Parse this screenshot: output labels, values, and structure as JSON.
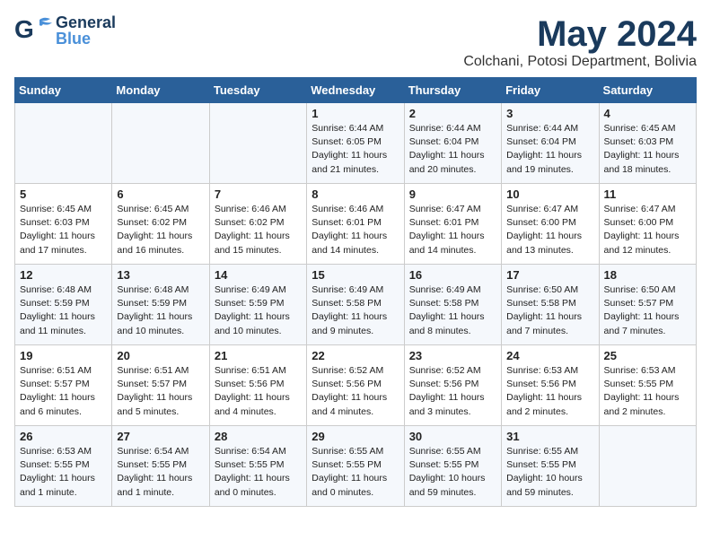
{
  "header": {
    "logo_general": "General",
    "logo_blue": "Blue",
    "month": "May 2024",
    "location": "Colchani, Potosi Department, Bolivia"
  },
  "days_of_week": [
    "Sunday",
    "Monday",
    "Tuesday",
    "Wednesday",
    "Thursday",
    "Friday",
    "Saturday"
  ],
  "weeks": [
    [
      {
        "day": "",
        "content": ""
      },
      {
        "day": "",
        "content": ""
      },
      {
        "day": "",
        "content": ""
      },
      {
        "day": "1",
        "content": "Sunrise: 6:44 AM\nSunset: 6:05 PM\nDaylight: 11 hours\nand 21 minutes."
      },
      {
        "day": "2",
        "content": "Sunrise: 6:44 AM\nSunset: 6:04 PM\nDaylight: 11 hours\nand 20 minutes."
      },
      {
        "day": "3",
        "content": "Sunrise: 6:44 AM\nSunset: 6:04 PM\nDaylight: 11 hours\nand 19 minutes."
      },
      {
        "day": "4",
        "content": "Sunrise: 6:45 AM\nSunset: 6:03 PM\nDaylight: 11 hours\nand 18 minutes."
      }
    ],
    [
      {
        "day": "5",
        "content": "Sunrise: 6:45 AM\nSunset: 6:03 PM\nDaylight: 11 hours\nand 17 minutes."
      },
      {
        "day": "6",
        "content": "Sunrise: 6:45 AM\nSunset: 6:02 PM\nDaylight: 11 hours\nand 16 minutes."
      },
      {
        "day": "7",
        "content": "Sunrise: 6:46 AM\nSunset: 6:02 PM\nDaylight: 11 hours\nand 15 minutes."
      },
      {
        "day": "8",
        "content": "Sunrise: 6:46 AM\nSunset: 6:01 PM\nDaylight: 11 hours\nand 14 minutes."
      },
      {
        "day": "9",
        "content": "Sunrise: 6:47 AM\nSunset: 6:01 PM\nDaylight: 11 hours\nand 14 minutes."
      },
      {
        "day": "10",
        "content": "Sunrise: 6:47 AM\nSunset: 6:00 PM\nDaylight: 11 hours\nand 13 minutes."
      },
      {
        "day": "11",
        "content": "Sunrise: 6:47 AM\nSunset: 6:00 PM\nDaylight: 11 hours\nand 12 minutes."
      }
    ],
    [
      {
        "day": "12",
        "content": "Sunrise: 6:48 AM\nSunset: 5:59 PM\nDaylight: 11 hours\nand 11 minutes."
      },
      {
        "day": "13",
        "content": "Sunrise: 6:48 AM\nSunset: 5:59 PM\nDaylight: 11 hours\nand 10 minutes."
      },
      {
        "day": "14",
        "content": "Sunrise: 6:49 AM\nSunset: 5:59 PM\nDaylight: 11 hours\nand 10 minutes."
      },
      {
        "day": "15",
        "content": "Sunrise: 6:49 AM\nSunset: 5:58 PM\nDaylight: 11 hours\nand 9 minutes."
      },
      {
        "day": "16",
        "content": "Sunrise: 6:49 AM\nSunset: 5:58 PM\nDaylight: 11 hours\nand 8 minutes."
      },
      {
        "day": "17",
        "content": "Sunrise: 6:50 AM\nSunset: 5:58 PM\nDaylight: 11 hours\nand 7 minutes."
      },
      {
        "day": "18",
        "content": "Sunrise: 6:50 AM\nSunset: 5:57 PM\nDaylight: 11 hours\nand 7 minutes."
      }
    ],
    [
      {
        "day": "19",
        "content": "Sunrise: 6:51 AM\nSunset: 5:57 PM\nDaylight: 11 hours\nand 6 minutes."
      },
      {
        "day": "20",
        "content": "Sunrise: 6:51 AM\nSunset: 5:57 PM\nDaylight: 11 hours\nand 5 minutes."
      },
      {
        "day": "21",
        "content": "Sunrise: 6:51 AM\nSunset: 5:56 PM\nDaylight: 11 hours\nand 4 minutes."
      },
      {
        "day": "22",
        "content": "Sunrise: 6:52 AM\nSunset: 5:56 PM\nDaylight: 11 hours\nand 4 minutes."
      },
      {
        "day": "23",
        "content": "Sunrise: 6:52 AM\nSunset: 5:56 PM\nDaylight: 11 hours\nand 3 minutes."
      },
      {
        "day": "24",
        "content": "Sunrise: 6:53 AM\nSunset: 5:56 PM\nDaylight: 11 hours\nand 2 minutes."
      },
      {
        "day": "25",
        "content": "Sunrise: 6:53 AM\nSunset: 5:55 PM\nDaylight: 11 hours\nand 2 minutes."
      }
    ],
    [
      {
        "day": "26",
        "content": "Sunrise: 6:53 AM\nSunset: 5:55 PM\nDaylight: 11 hours\nand 1 minute."
      },
      {
        "day": "27",
        "content": "Sunrise: 6:54 AM\nSunset: 5:55 PM\nDaylight: 11 hours\nand 1 minute."
      },
      {
        "day": "28",
        "content": "Sunrise: 6:54 AM\nSunset: 5:55 PM\nDaylight: 11 hours\nand 0 minutes."
      },
      {
        "day": "29",
        "content": "Sunrise: 6:55 AM\nSunset: 5:55 PM\nDaylight: 11 hours\nand 0 minutes."
      },
      {
        "day": "30",
        "content": "Sunrise: 6:55 AM\nSunset: 5:55 PM\nDaylight: 10 hours\nand 59 minutes."
      },
      {
        "day": "31",
        "content": "Sunrise: 6:55 AM\nSunset: 5:55 PM\nDaylight: 10 hours\nand 59 minutes."
      },
      {
        "day": "",
        "content": ""
      }
    ]
  ]
}
